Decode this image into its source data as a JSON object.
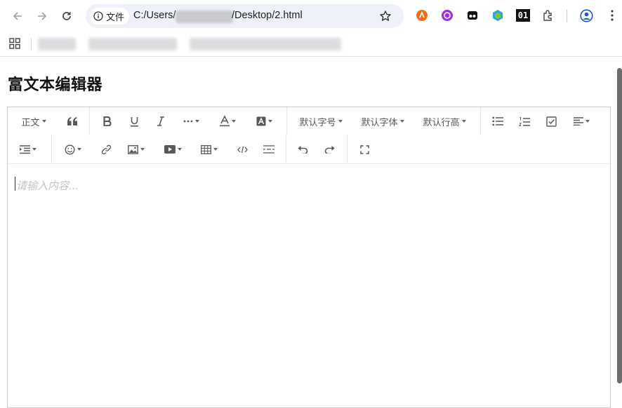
{
  "browser": {
    "site_chip_label": "文件",
    "url_prefix": "C:/Users/",
    "url_suffix": "/Desktop/2.html",
    "extension_labels": {
      "ext4": "01"
    }
  },
  "page": {
    "title": "富文本编辑器"
  },
  "toolbar": {
    "header_select": "正文",
    "font_size_select": "默认字号",
    "font_family_select": "默认字体",
    "line_height_select": "默认行高"
  },
  "editor": {
    "placeholder": "请输入内容..."
  },
  "colors": {
    "chrome_omnibox": "#eef1f7",
    "editor_border": "#cccccc",
    "icon": "#595959",
    "placeholder": "#c4c4c4"
  }
}
